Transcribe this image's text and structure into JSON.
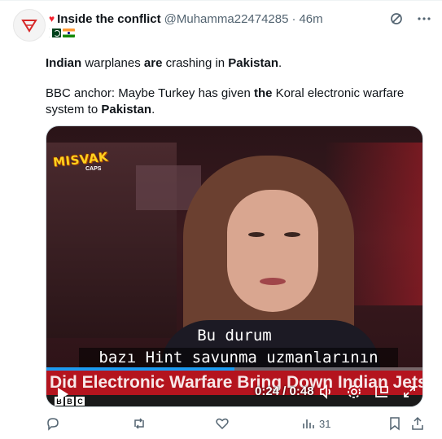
{
  "tweet": {
    "author_name": "Inside the conflict",
    "handle": "@Muhamma22474285",
    "separator": "·",
    "time": "46m",
    "flags": [
      "pakistan-flag",
      "india-flag"
    ],
    "line1": {
      "a": "Indian",
      "b": " warplanes ",
      "c": "are",
      "d": " crashing in ",
      "e": "Pakistan",
      "f": "."
    },
    "line2": {
      "a": "BBC anchor: Maybe Turkey has given ",
      "b": "the",
      "c": " Koral electronic warfare system to ",
      "d": "Pakistan",
      "e": "."
    }
  },
  "video": {
    "logo_text": "MISVAK",
    "logo_sub": "CAPS",
    "subtitle_line1": "Bu durum",
    "subtitle_line2": "bazı Hint savunma uzmanlarının",
    "ticker": "Did Electronic Warfare Bring Down Indian Jets?",
    "channel_logo": [
      "B",
      "B",
      "C"
    ],
    "current_time": "0:24",
    "duration": "0:48",
    "time_display": "0:24 / 0:48",
    "progress": 0.5,
    "progress_color": "#1d9bf0"
  },
  "actions": {
    "views": "31"
  },
  "colors": {
    "accent": "#1d9bf0",
    "ticker_red": "#b4141e",
    "secondary_text": "#536471"
  }
}
